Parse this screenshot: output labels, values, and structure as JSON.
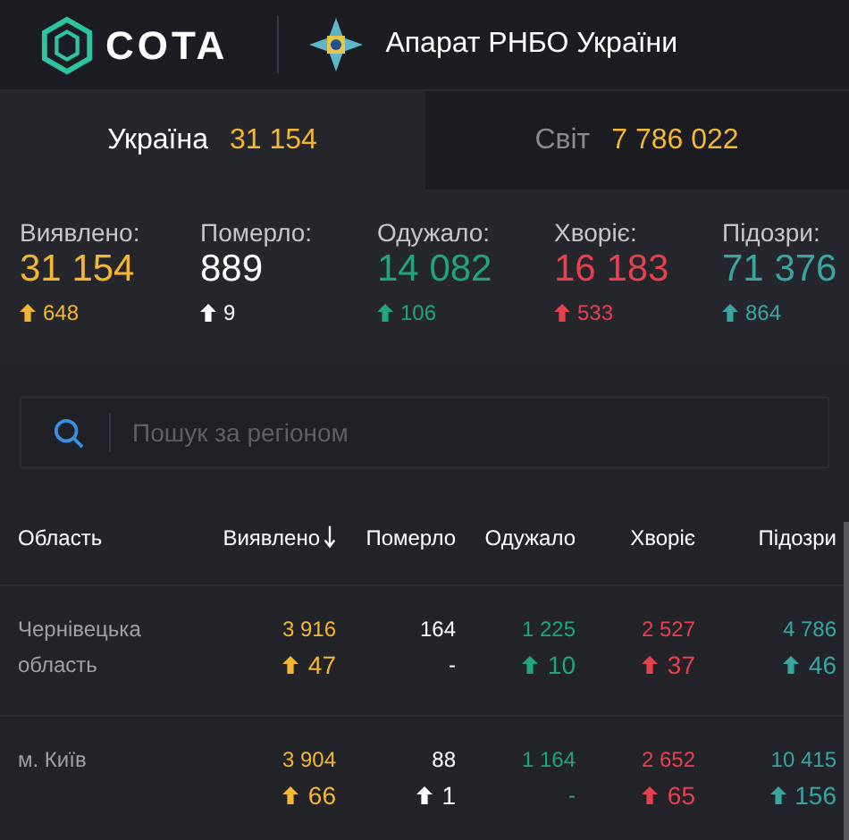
{
  "header": {
    "brand": "COTA",
    "title": "Апарат РНБО України"
  },
  "tabs": [
    {
      "label": "Україна",
      "count": "31 154",
      "selected": true
    },
    {
      "label": "Світ",
      "count": "7 786 022",
      "selected": false
    }
  ],
  "stats": [
    {
      "kind": "confirmed",
      "label": "Виявлено:",
      "value": "31 154",
      "delta": "648"
    },
    {
      "kind": "deaths",
      "label": "Померло:",
      "value": "889",
      "delta": "9"
    },
    {
      "kind": "recovered",
      "label": "Одужало:",
      "value": "14 082",
      "delta": "106"
    },
    {
      "kind": "sick",
      "label": "Хворіє:",
      "value": "16 183",
      "delta": "533"
    },
    {
      "kind": "suspected",
      "label": "Підозри:",
      "value": "71 376",
      "delta": "864"
    }
  ],
  "search": {
    "placeholder": "Пошук за регіоном"
  },
  "table": {
    "columns": [
      {
        "label": "Область",
        "kind": "region",
        "sorted": false
      },
      {
        "label": "Виявлено",
        "kind": "confirmed",
        "sorted": true
      },
      {
        "label": "Померло",
        "kind": "deaths",
        "sorted": false
      },
      {
        "label": "Одужало",
        "kind": "recovered",
        "sorted": false
      },
      {
        "label": "Хворіє",
        "kind": "sick",
        "sorted": false
      },
      {
        "label": "Підозри",
        "kind": "suspected",
        "sorted": false
      }
    ],
    "rows": [
      {
        "cells": [
          {
            "value": "Чернівецька область"
          },
          {
            "value": "3 916",
            "delta": "47",
            "rising": true
          },
          {
            "value": "164",
            "delta": "-",
            "rising": false
          },
          {
            "value": "1 225",
            "delta": "10",
            "rising": true
          },
          {
            "value": "2 527",
            "delta": "37",
            "rising": true
          },
          {
            "value": "4 786",
            "delta": "46",
            "rising": true
          }
        ]
      },
      {
        "cells": [
          {
            "value": "м. Київ"
          },
          {
            "value": "3 904",
            "delta": "66",
            "rising": true
          },
          {
            "value": "88",
            "delta": "1",
            "rising": true
          },
          {
            "value": "1 164",
            "delta": "-",
            "rising": false
          },
          {
            "value": "2 652",
            "delta": "65",
            "rising": true
          },
          {
            "value": "10 415",
            "delta": "156",
            "rising": true
          }
        ]
      }
    ]
  }
}
